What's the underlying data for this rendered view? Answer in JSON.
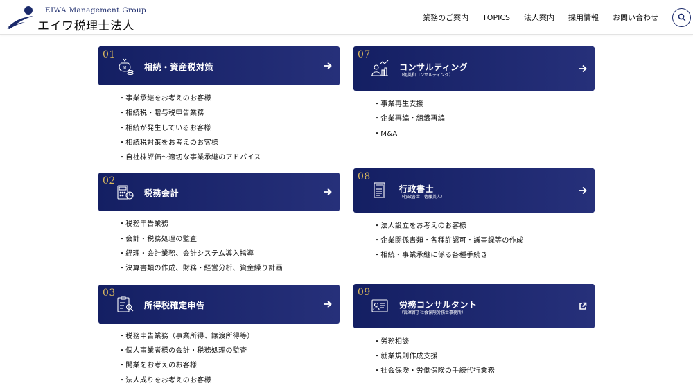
{
  "header": {
    "logo_en": "EIWA Management Group",
    "logo_ja": "エイワ税理士法人",
    "nav": [
      "業務のご案内",
      "TOPICS",
      "法人案内",
      "採用情報",
      "お問い合わせ"
    ],
    "search_icon": "search-icon"
  },
  "colors": {
    "navy": "#1b2a6b",
    "card_dark": "#141f63",
    "card_light": "#26307a",
    "gold": "#d9b75d"
  },
  "services_left": [
    {
      "num": "01",
      "title": "相続・資産税対策",
      "icon": "money-bag-icon",
      "arrow": "arrow-right-icon",
      "items": [
        "・事業承継をお考えのお客様",
        "・相続税・贈与税申告業務",
        "・相続が発生しているお客様",
        "・相続税対策をお考えのお客様",
        "・自社株評価～適切な事業承継のアドバイス"
      ]
    },
    {
      "num": "02",
      "title": "税務会計",
      "icon": "calculator-icon",
      "arrow": "arrow-right-icon",
      "items": [
        "・税務申告業務",
        "・会計・税務処理の監査",
        "・経理・会計業務、会計システム導入指導",
        "・決算書類の作成、財務・経営分析、資金繰り計画"
      ]
    },
    {
      "num": "03",
      "title": "所得税確定申告",
      "icon": "clipboard-icon",
      "arrow": "arrow-right-icon",
      "items": [
        "・税務申告業務（事業所得、譲渡所得等）",
        "・個人事業者様の会計・税務処理の監査",
        "・開業をお考えのお客様",
        "・法人成りをお考えのお客様"
      ]
    }
  ],
  "services_right": [
    {
      "num": "07",
      "title": "コンサルティング",
      "sub": "（衛英和コンサルティング）",
      "icon": "consulting-icon",
      "arrow": "arrow-right-icon",
      "items": [
        "・事業再生支援",
        "・企業再編・組織再編",
        "・M&A"
      ]
    },
    {
      "num": "08",
      "title": "行政書士",
      "sub": "（行政書士　佐藤英人）",
      "icon": "document-icon",
      "arrow": "arrow-right-icon",
      "items": [
        "・法人設立をお考えのお客様",
        "・企業関係書類・各種許認可・議事録等の作成",
        "・相続・事業承継に係る各種手続き"
      ]
    },
    {
      "num": "09",
      "title": "労務コンサルタント",
      "sub": "（宮澤啓子社会保険労務士事務所）",
      "icon": "id-card-icon",
      "arrow": "external-link-icon",
      "items": [
        "・労務相談",
        "・就業規則作成支援",
        "・社会保険・労働保険の手続代行業務"
      ]
    }
  ]
}
